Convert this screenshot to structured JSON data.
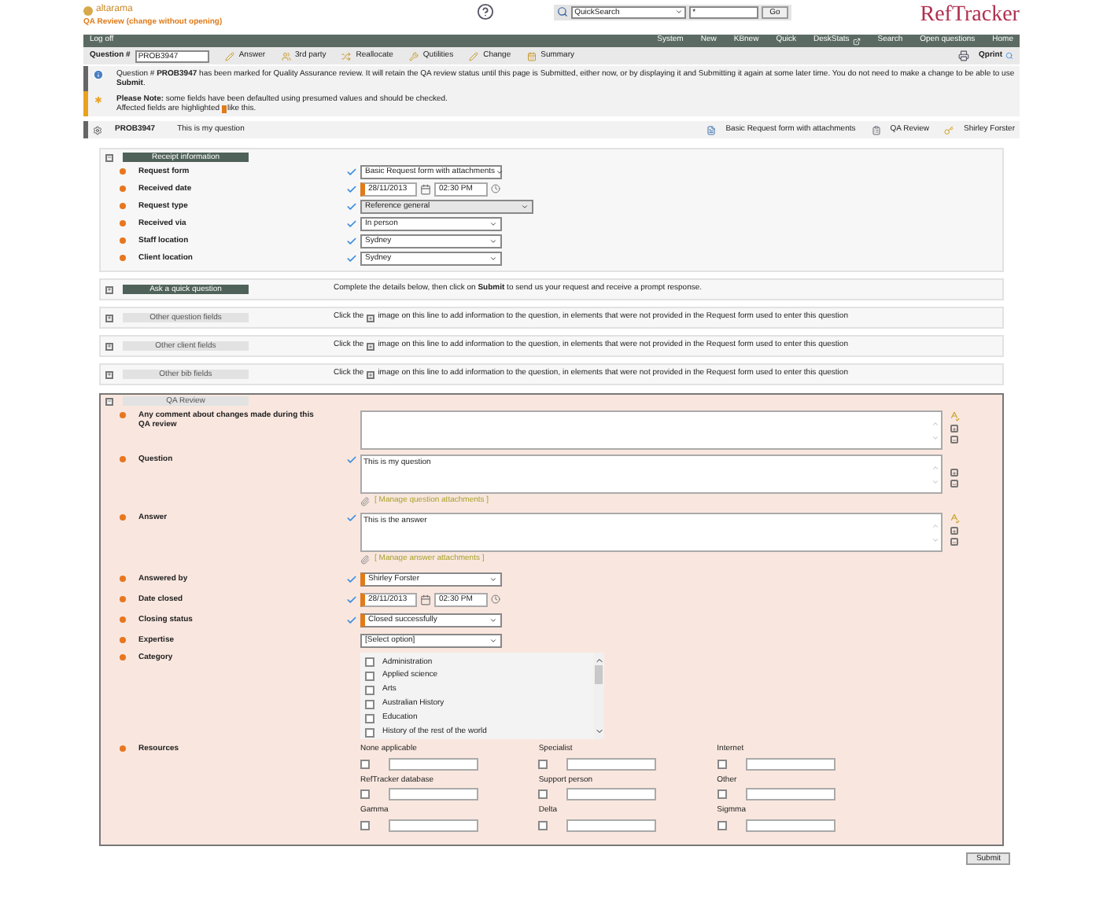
{
  "app": {
    "logo": "altarama",
    "mode": "QA Review (change without opening)",
    "brand": "RefTracker"
  },
  "quicksearch": {
    "option": "QuickSearch",
    "value": "*",
    "button": "Go"
  },
  "nav": {
    "left": "Log off",
    "items": [
      {
        "label": "System",
        "icon": false
      },
      {
        "label": "New",
        "icon": false
      },
      {
        "label": "KBnew",
        "icon": false
      },
      {
        "label": "Quick",
        "icon": false
      },
      {
        "label": "DeskStats",
        "icon": true
      },
      {
        "label": "Search",
        "icon": false
      },
      {
        "label": "Open questions",
        "icon": false
      },
      {
        "label": "Home",
        "icon": false
      }
    ]
  },
  "toolbar": {
    "label": "Question #",
    "value": "PROB3947",
    "actions": [
      "Answer",
      "3rd party",
      "Reallocate",
      "Qutilities",
      "Change",
      "Summary"
    ],
    "print": "Qprint"
  },
  "notices": [
    {
      "kind": "info",
      "text": "Question # **PROB3947** has been marked for Quality Assurance review. It will retain the QA review status until this page is Submitted, either now, or by displaying it and Submitting it again at some later time. You do not need to make a change to be able to use **Submit**."
    },
    {
      "kind": "warning",
      "text": "**Please Note:** some fields have been defaulted using presumed values and should be checked.",
      "hint_before": "Affected fields are highlighted",
      "hint_after": "like this."
    }
  ],
  "question_bar": {
    "id": "PROB3947",
    "title": "This is my question",
    "form": "Basic Request form with attachments",
    "status": "QA Review",
    "user": "Shirley Forster"
  },
  "receipt": {
    "title": "Receipt information",
    "enabled": true,
    "expanded": true,
    "fields": [
      {
        "label": "Request form",
        "kind": "select",
        "value": "Basic Request form with attachments",
        "verified": true,
        "highlighted": false,
        "disabled": false
      },
      {
        "label": "Received date",
        "kind": "datetime",
        "date": "28/11/2013",
        "time": "02:30 PM",
        "verified": true,
        "highlighted": true
      },
      {
        "label": "Request type",
        "kind": "select",
        "value": "Reference general",
        "verified": true,
        "highlighted": false,
        "disabled": true
      },
      {
        "label": "Received via",
        "kind": "select",
        "value": "In person",
        "verified": true,
        "highlighted": false,
        "disabled": false
      },
      {
        "label": "Staff location",
        "kind": "select",
        "value": "Sydney",
        "verified": true,
        "highlighted": false,
        "disabled": false
      },
      {
        "label": "Client location",
        "kind": "select",
        "value": "Sydney",
        "verified": true,
        "highlighted": false,
        "disabled": false
      }
    ]
  },
  "sections": [
    {
      "title": "Ask a quick question",
      "enabled": true,
      "expanded": false,
      "kind": "intro",
      "text": "Complete the details below, then click on **Submit** to send us your request and receive a prompt response."
    },
    {
      "title": "Other question fields",
      "enabled": false,
      "expanded": false,
      "kind": "add",
      "before": "Click the",
      "after": "image on this line to add information to the question, in elements that were not provided in the Request form used to enter this question"
    },
    {
      "title": "Other client fields",
      "enabled": false,
      "expanded": false,
      "kind": "add",
      "before": "Click the",
      "after": "image on this line to add information to the question, in elements that were not provided in the Request form used to enter this question"
    },
    {
      "title": "Other bib fields",
      "enabled": false,
      "expanded": false,
      "kind": "add",
      "before": "Click the",
      "after": "image on this line to add information to the question, in elements that were not provided in the Request form used to enter this question"
    }
  ],
  "qa": {
    "title": "QA Review",
    "enabled": false,
    "expanded": true,
    "fields": [
      {
        "label": "Any comment about changes made during this QA review",
        "kind": "textarea",
        "verified": false,
        "spellcheck": true
      },
      {
        "label": "Question",
        "kind": "textarea",
        "value": "This is my question",
        "verified": true,
        "spellcheck": false,
        "link": "[ Manage question attachments ]"
      },
      {
        "label": "Answer",
        "kind": "textarea",
        "value": "This is the answer",
        "verified": true,
        "spellcheck": true,
        "link": "[ Manage answer attachments ]"
      },
      {
        "label": "Answered by",
        "kind": "select",
        "value": "Shirley Forster",
        "verified": true,
        "highlighted": true,
        "disabled": false
      },
      {
        "label": "Date closed",
        "kind": "datetime",
        "date": "28/11/2013",
        "time": "02:30 PM",
        "verified": true,
        "highlighted": true
      },
      {
        "label": "Closing status",
        "kind": "select",
        "value": "Closed successfully",
        "verified": true,
        "highlighted": true,
        "disabled": false
      },
      {
        "label": "Expertise",
        "kind": "select",
        "value": "[Select option]",
        "verified": false,
        "highlighted": false,
        "disabled": false
      },
      {
        "label": "Category",
        "kind": "checklist",
        "items": [
          {
            "label": "Administration",
            "checked": false
          },
          {
            "label": "Applied science",
            "checked": false
          },
          {
            "label": "Arts",
            "checked": false
          },
          {
            "label": "Australian History",
            "checked": false
          },
          {
            "label": "Education",
            "checked": false
          },
          {
            "label": "History of the rest of the world",
            "checked": false
          }
        ]
      },
      {
        "label": "Resources",
        "kind": "resources",
        "items": [
          {
            "label": "None applicable",
            "checked": false
          },
          {
            "label": "Specialist",
            "checked": false
          },
          {
            "label": "Internet",
            "checked": false
          },
          {
            "label": "RefTracker database",
            "checked": false
          },
          {
            "label": "Support person",
            "checked": false
          },
          {
            "label": "Other",
            "checked": false
          },
          {
            "label": "Gamma",
            "checked": false
          },
          {
            "label": "Delta",
            "checked": false
          },
          {
            "label": "Sigmma",
            "checked": false
          }
        ]
      }
    ]
  },
  "submit": "Submit"
}
